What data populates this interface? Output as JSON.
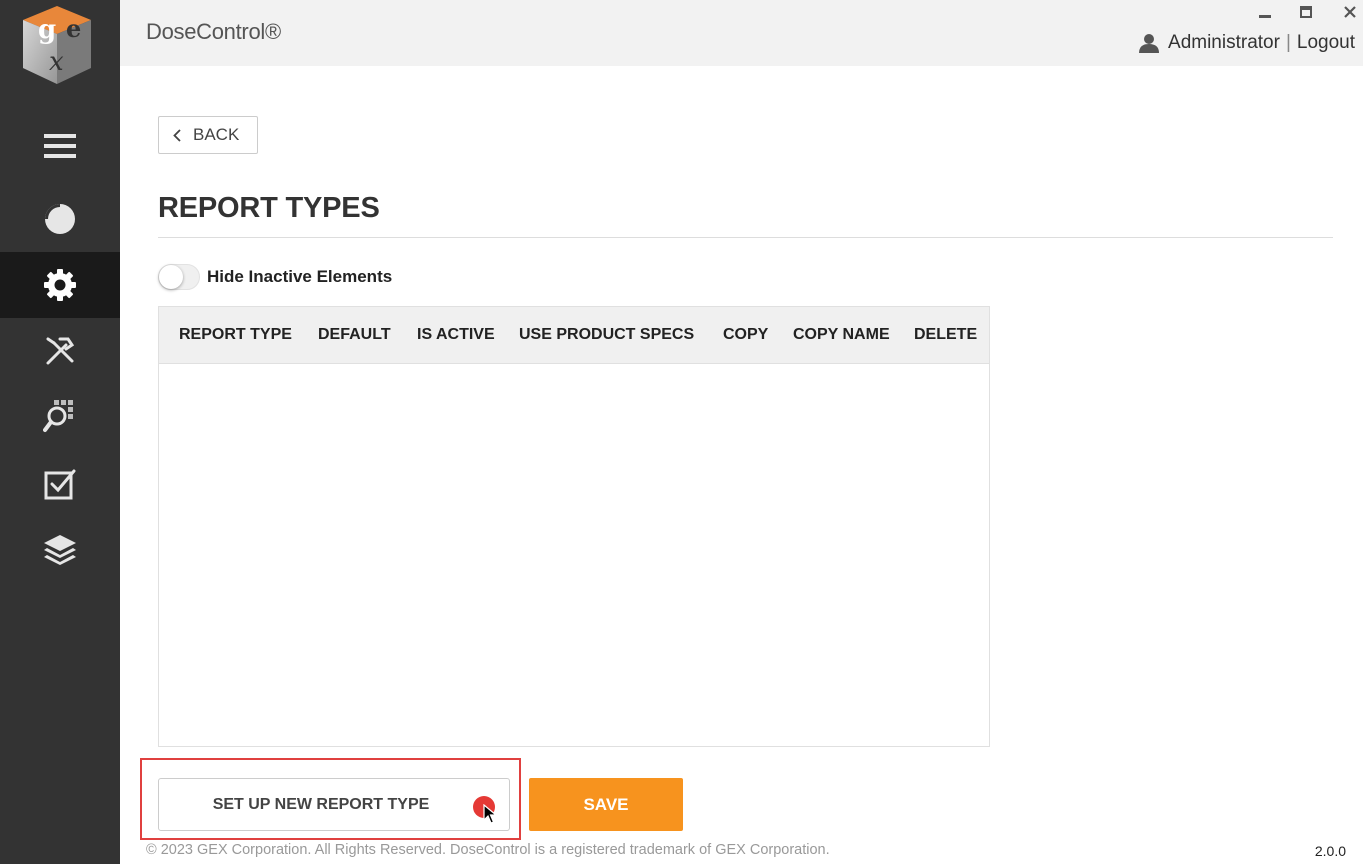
{
  "app": {
    "title": "DoseControl®",
    "logo_letters": [
      "g",
      "e",
      "x"
    ]
  },
  "window_controls": {
    "minimize_icon": "minimize-icon",
    "maximize_icon": "maximize-icon",
    "close_icon": "close-icon"
  },
  "user": {
    "name": "Administrator",
    "separator": "|",
    "logout_label": "Logout"
  },
  "sidebar": {
    "items": [
      {
        "icon": "hamburger-menu-icon",
        "active": false
      },
      {
        "icon": "dashboard-pie-icon",
        "active": false
      },
      {
        "icon": "settings-gear-icon",
        "active": true
      },
      {
        "icon": "tools-icon",
        "active": false
      },
      {
        "icon": "search-grid-icon",
        "active": false
      },
      {
        "icon": "checkbox-icon",
        "active": false
      },
      {
        "icon": "layers-icon",
        "active": false
      }
    ]
  },
  "back_button": {
    "label": "BACK"
  },
  "page": {
    "title": "REPORT TYPES"
  },
  "filter": {
    "label": "Hide Inactive Elements",
    "enabled": false
  },
  "table": {
    "columns": [
      "REPORT TYPE",
      "DEFAULT",
      "IS ACTIVE",
      "USE PRODUCT SPECS",
      "COPY",
      "COPY NAME",
      "DELETE"
    ],
    "rows": []
  },
  "actions": {
    "setup_label": "SET UP NEW REPORT TYPE",
    "save_label": "SAVE"
  },
  "footer": {
    "copyright": "© 2023 GEX Corporation. All Rights Reserved. DoseControl is a registered trademark of GEX Corporation.",
    "version": "2.0.0"
  },
  "colors": {
    "sidebar_bg": "#333333",
    "sidebar_active": "#1a1a1a",
    "accent": "#f7931e",
    "highlight_border": "#e0403f"
  }
}
